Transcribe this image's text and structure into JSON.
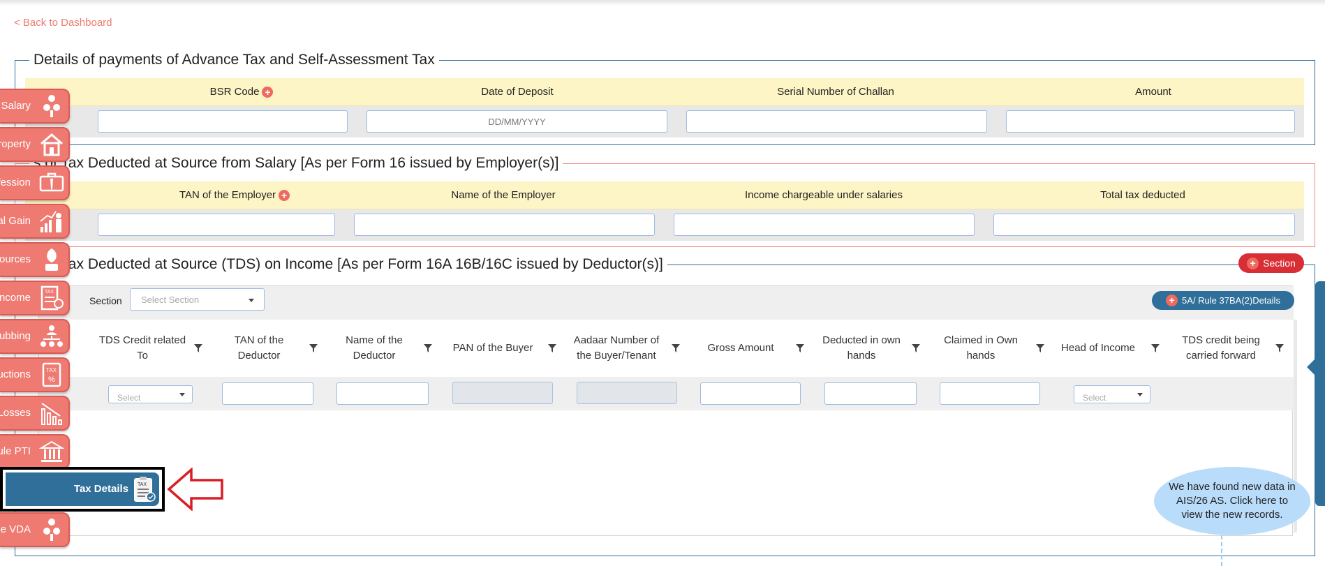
{
  "back_link": "< Back to Dashboard",
  "advance_tax": {
    "title": "Details of payments of Advance Tax and Self-Assessment Tax",
    "columns": [
      "BSR Code",
      "Date of Deposit",
      "Serial Number of Challan",
      "Amount"
    ],
    "date_placeholder": "DD/MM/YYYY"
  },
  "tds_salary": {
    "title": "s of Tax Deducted at Source from Salary [As per Form 16 issued by Employer(s)]",
    "columns": [
      "TAN of the Employer",
      "Name of the Employer",
      "Income chargeable under salaries",
      "Total tax deducted"
    ]
  },
  "tds_income": {
    "title": "s of Tax Deducted at Source (TDS) on Income [As per Form 16A 16B/16C issued by Deductor(s)]",
    "section_button": "Section",
    "rule_button": "5A/ Rule 37BA(2)Details",
    "section_label": "Section",
    "section_placeholder": "Select Section",
    "columns": [
      "TDS Credit related To",
      "TAN of the Deductor",
      "Name of the Deductor",
      "PAN of the Buyer",
      "Aadaar Number of the Buyer/Tenant",
      "Gross Amount",
      "Deducted in own hands",
      "Claimed in Own hands",
      "Head of Income",
      "TDS credit being carried forward"
    ],
    "select_placeholder": "Select"
  },
  "sidebar": {
    "items": [
      {
        "label": "Salary",
        "icon": "salary-icon"
      },
      {
        "label": "roperty",
        "icon": "house-icon"
      },
      {
        "label": "fession",
        "icon": "briefcase-icon"
      },
      {
        "label": "al Gain",
        "icon": "capital-gain-icon"
      },
      {
        "label": "Sources",
        "icon": "plant-icon"
      },
      {
        "label": "ncome",
        "icon": "tax-document-icon"
      },
      {
        "label": "ubbing",
        "icon": "clubbing-icon"
      },
      {
        "label": "uctions",
        "icon": "tax-percent-icon"
      },
      {
        "label": "Losses",
        "icon": "losses-icon"
      },
      {
        "label": "ule PTI",
        "icon": "bank-icon"
      },
      {
        "label": "Tax Details",
        "icon": "tax-clipboard-icon"
      },
      {
        "label": "ule VDA",
        "icon": "vda-icon"
      }
    ]
  },
  "notification": "We have found new data in AIS/26 AS. Click here to view the new records.",
  "colors": {
    "accent_blue": "#2f6f9a",
    "sidebar_red": "#ee7a72",
    "header_yellow": "#fdf5c5",
    "danger_red": "#d82e35"
  }
}
